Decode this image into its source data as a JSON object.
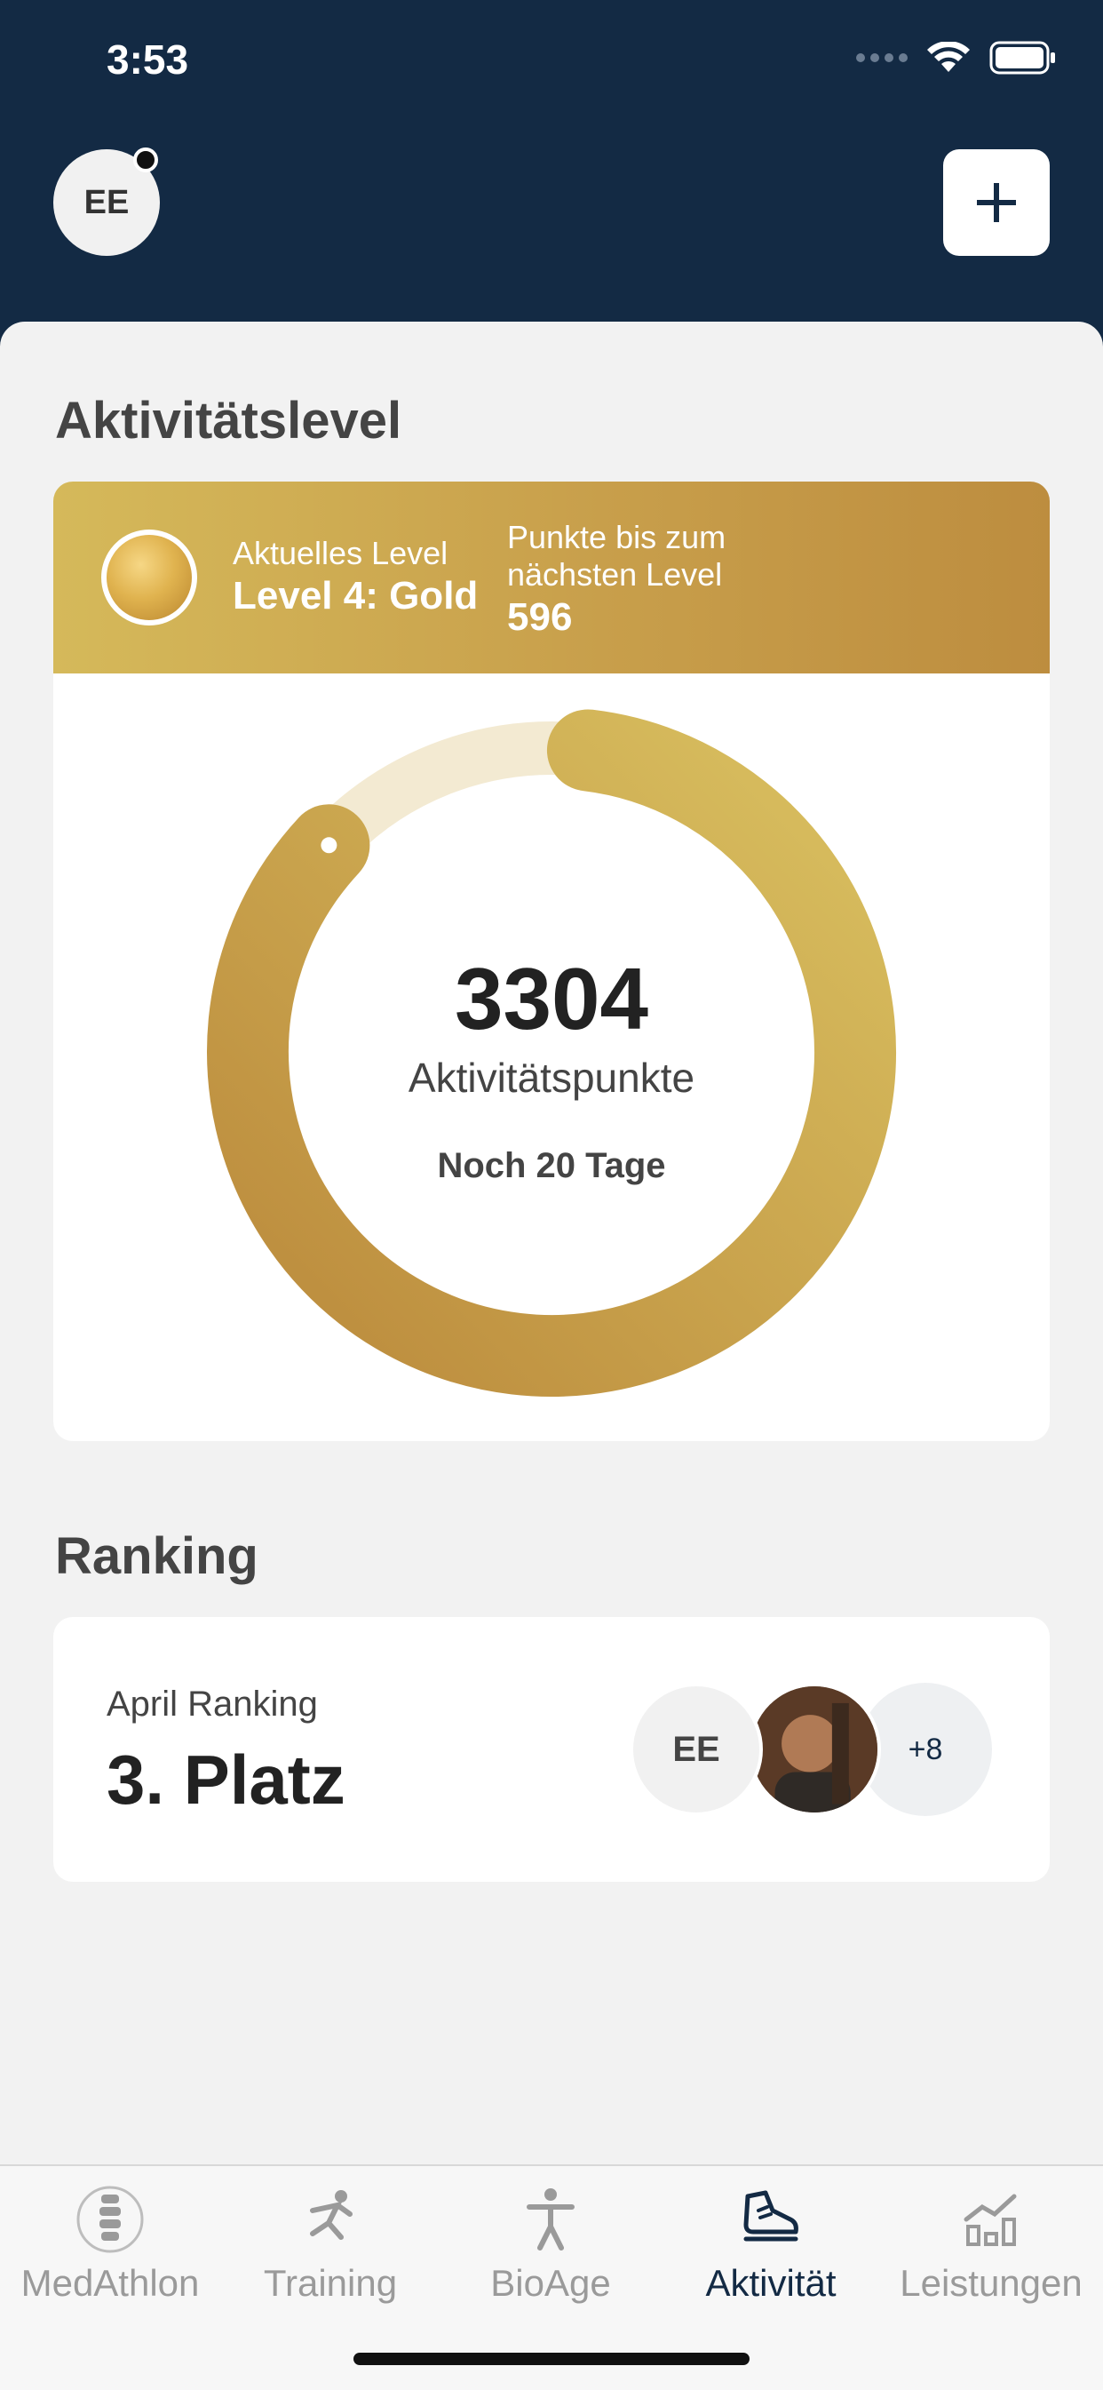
{
  "status_bar": {
    "time": "3:53"
  },
  "header": {
    "avatar_initials": "EE",
    "add_label": "+"
  },
  "activity": {
    "section_title": "Aktivitätslevel",
    "current_level_label": "Aktuelles Level",
    "current_level_value": "Level 4: Gold",
    "points_to_next_label_line1": "Punkte bis zum",
    "points_to_next_label_line2": "nächsten Level",
    "points_to_next_value": "596",
    "points": "3304",
    "points_label": "Aktivitätspunkte",
    "days_remaining": "Noch 20 Tage",
    "progress_fraction": 0.85
  },
  "ranking": {
    "section_title": "Ranking",
    "label": "April Ranking",
    "place": "3. Platz",
    "participant_initials": "EE",
    "more_count": "+8"
  },
  "tabbar": {
    "tabs": [
      {
        "label": "MedAthlon",
        "icon": "spine-icon",
        "active": false
      },
      {
        "label": "Training",
        "icon": "running-icon",
        "active": false
      },
      {
        "label": "BioAge",
        "icon": "person-icon",
        "active": false
      },
      {
        "label": "Aktivität",
        "icon": "shoe-icon",
        "active": true
      },
      {
        "label": "Leistungen",
        "icon": "chart-icon",
        "active": false
      }
    ]
  },
  "colors": {
    "header_bg": "#132a44",
    "gold_light": "#d5b95a",
    "gold_dark": "#bd8d3f",
    "ring_track": "#f3ead2",
    "active_tab": "#132a44",
    "inactive_tab": "#9a9a9a"
  }
}
